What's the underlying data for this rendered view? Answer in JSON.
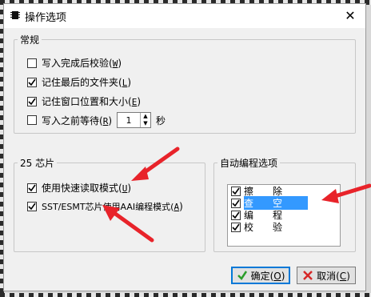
{
  "window": {
    "title": "操作选项",
    "close_glyph": "✕"
  },
  "general": {
    "legend": "常规",
    "items": [
      {
        "label": "写入完成后校验(",
        "hotkey": "W",
        "suffix": ")",
        "checked": false
      },
      {
        "label": "记住最后的文件夹(",
        "hotkey": "L",
        "suffix": ")",
        "checked": true
      },
      {
        "label": "记住窗口位置和大小(",
        "hotkey": "E",
        "suffix": ")",
        "checked": true
      },
      {
        "label": "写入之前等待(",
        "hotkey": "R",
        "suffix": ")",
        "checked": false
      }
    ],
    "wait_value": "1",
    "wait_unit": "秒"
  },
  "chip25": {
    "legend": "25 芯片",
    "items": [
      {
        "label": "使用快速读取模式(",
        "hotkey": "U",
        "suffix": ")",
        "checked": true
      },
      {
        "label": "SST/ESMT芯片使用AAI编程模式(",
        "hotkey": "A",
        "suffix": ")",
        "checked": true
      }
    ]
  },
  "auto": {
    "legend": "自动编程选项",
    "items": [
      {
        "label": "擦　　除",
        "checked": true,
        "selected": false
      },
      {
        "label": "查　　空",
        "checked": true,
        "selected": true
      },
      {
        "label": "编　　程",
        "checked": true,
        "selected": false
      },
      {
        "label": "校　　验",
        "checked": true,
        "selected": false
      }
    ]
  },
  "buttons": {
    "ok": {
      "label": "确定(",
      "hotkey": "O",
      "suffix": ")"
    },
    "cancel": {
      "label": "取消(",
      "hotkey": "C",
      "suffix": ")"
    }
  },
  "colors": {
    "accent": "#0078d7",
    "selection": "#3399ff",
    "arrow": "#e8232a",
    "ok_icon": "#2a9d2a",
    "cancel_icon": "#d62828"
  },
  "icons": [
    "chip-icon",
    "close-icon",
    "check-icon",
    "cross-icon",
    "spin-up-icon",
    "spin-down-icon"
  ]
}
